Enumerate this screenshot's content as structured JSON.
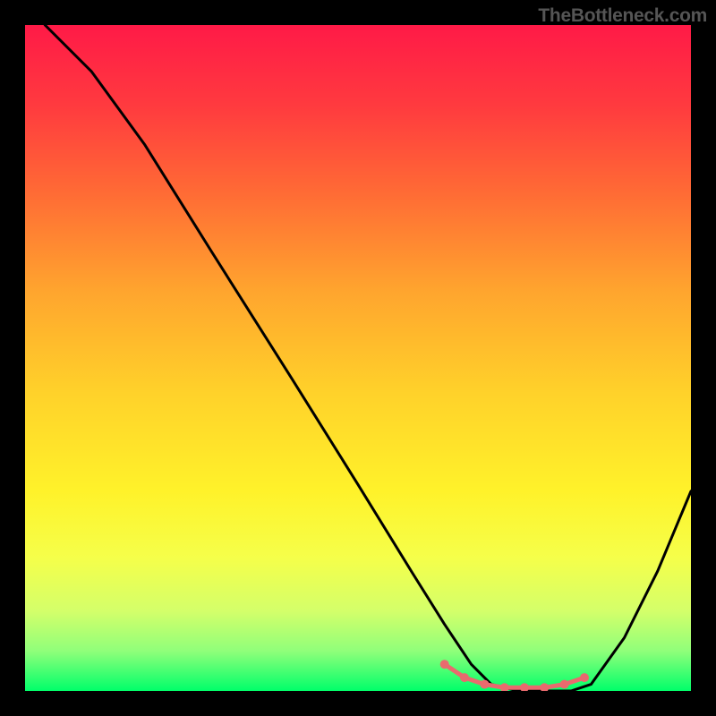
{
  "watermark": "TheBottleneck.com",
  "chart_data": {
    "type": "line",
    "title": "",
    "xlabel": "",
    "ylabel": "",
    "xlim": [
      0,
      100
    ],
    "ylim": [
      0,
      100
    ],
    "series": [
      {
        "name": "bottleneck-curve",
        "color": "#000000",
        "x": [
          3,
          10,
          18,
          28,
          40,
          50,
          58,
          63,
          67,
          70,
          74,
          78,
          82,
          85,
          90,
          95,
          100
        ],
        "y": [
          100,
          93,
          82,
          66,
          47,
          31,
          18,
          10,
          4,
          1,
          0,
          0,
          0,
          1,
          8,
          18,
          30
        ]
      }
    ],
    "series_markers": [
      {
        "name": "optimal-zone",
        "color": "#e96a6e",
        "marker": "circle",
        "x": [
          63,
          66,
          69,
          72,
          75,
          78,
          81,
          84
        ],
        "y": [
          4,
          2,
          1,
          0.5,
          0.5,
          0.5,
          1,
          2
        ]
      }
    ],
    "gradient_stops": [
      {
        "pos": 0.0,
        "color": "#ff1a47"
      },
      {
        "pos": 0.5,
        "color": "#ffd12a"
      },
      {
        "pos": 0.8,
        "color": "#f5ff4a"
      },
      {
        "pos": 1.0,
        "color": "#00ff6a"
      }
    ]
  }
}
